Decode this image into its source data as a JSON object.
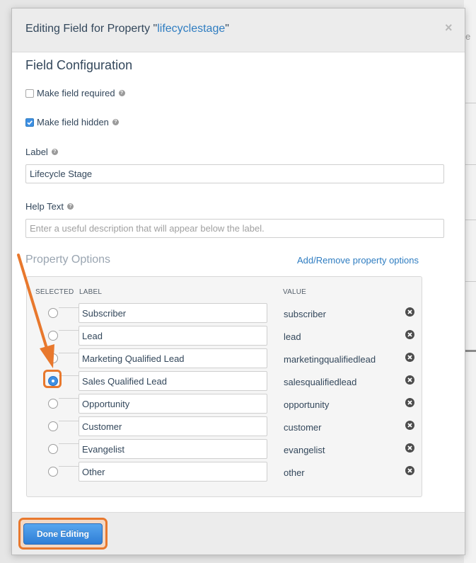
{
  "modal": {
    "title_prefix": "Editing Field for Property \"",
    "property_name": "lifecyclestage",
    "title_suffix": "\"",
    "close_symbol": "×"
  },
  "field_config": {
    "heading": "Field Configuration",
    "required_label": "Make field required",
    "required_checked": false,
    "hidden_label": "Make field hidden",
    "hidden_checked": true,
    "label_heading": "Label",
    "label_value": "Lifecycle Stage",
    "help_heading": "Help Text",
    "help_placeholder": "Enter a useful description that will appear below the label."
  },
  "property_options": {
    "heading": "Property Options",
    "add_remove_link": "Add/Remove property options",
    "columns": {
      "selected": "SELECTED",
      "label": "LABEL",
      "value": "VALUE"
    },
    "rows": [
      {
        "label": "Subscriber",
        "value": "subscriber",
        "selected": false
      },
      {
        "label": "Lead",
        "value": "lead",
        "selected": false
      },
      {
        "label": "Marketing Qualified Lead",
        "value": "marketingqualifiedlead",
        "selected": false
      },
      {
        "label": "Sales Qualified Lead",
        "value": "salesqualifiedlead",
        "selected": true
      },
      {
        "label": "Opportunity",
        "value": "opportunity",
        "selected": false
      },
      {
        "label": "Customer",
        "value": "customer",
        "selected": false
      },
      {
        "label": "Evangelist",
        "value": "evangelist",
        "selected": false
      },
      {
        "label": "Other",
        "value": "other",
        "selected": false
      }
    ]
  },
  "footer": {
    "done_label": "Done Editing"
  },
  "colors": {
    "accent_blue": "#2f7dc1",
    "annotation_orange": "#e8782d"
  },
  "icons": {
    "help": "question-circle-icon",
    "remove": "x-circle-icon",
    "close": "close-icon",
    "checkmark": "checkmark-icon"
  }
}
